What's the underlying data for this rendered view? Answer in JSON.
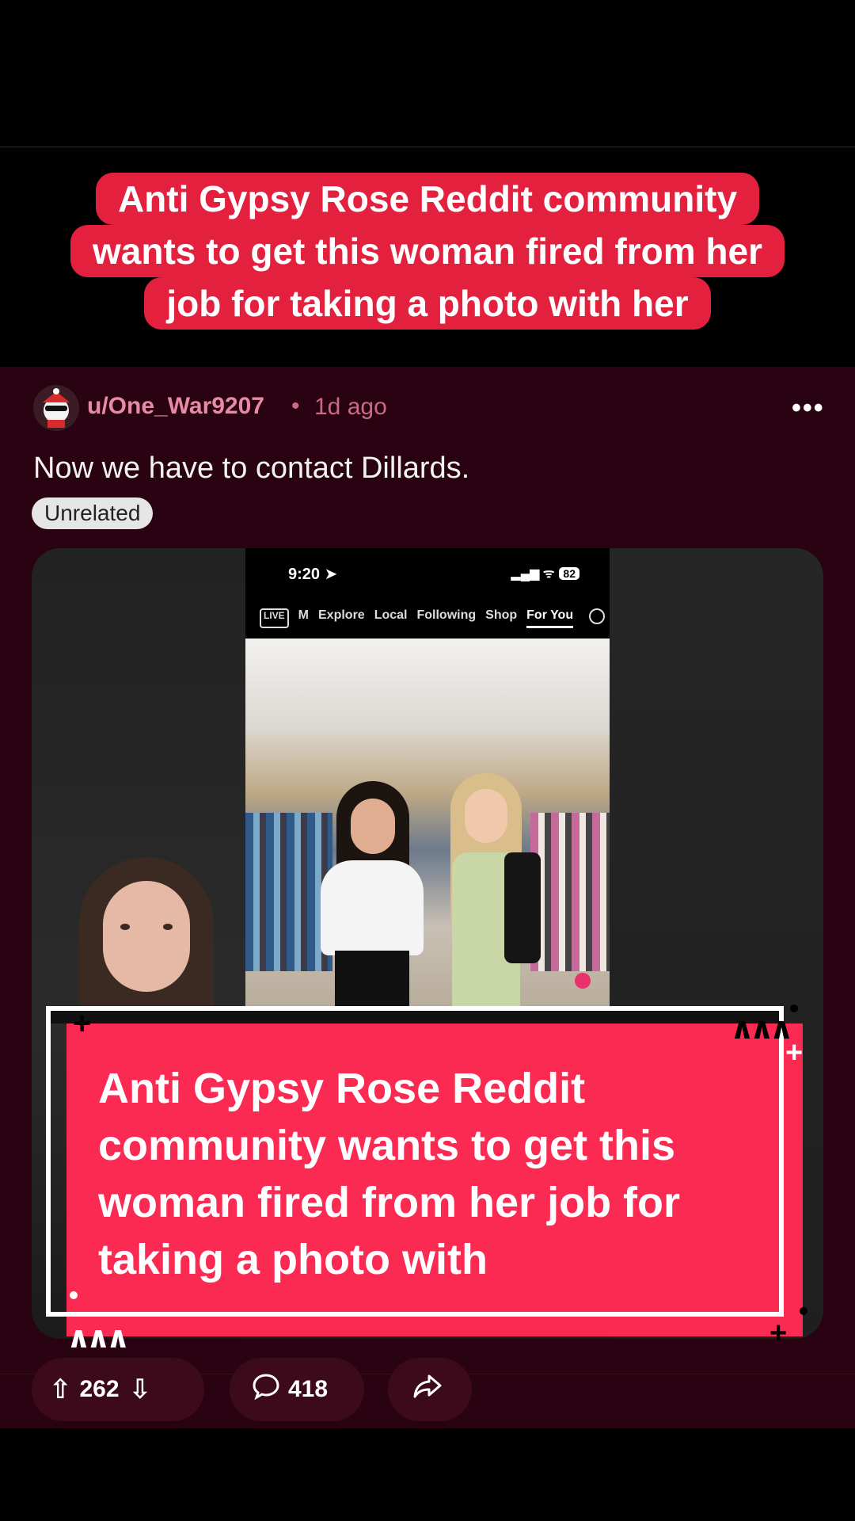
{
  "top_caption": {
    "line1": "Anti Gypsy Rose Reddit community",
    "line2": "wants to get this woman fired from her",
    "line3": "job for taking a photo with her"
  },
  "post": {
    "username": "u/One_War9207",
    "separator": "•",
    "age": "1d ago",
    "more_icon": "more-horizontal-icon",
    "title": "Now we have to contact Dillards.",
    "flair": "Unrelated"
  },
  "embedded_screen": {
    "time": "9:20",
    "battery": "82",
    "tabs": [
      "LIVE",
      "M",
      "Explore",
      "Local",
      "Following",
      "Shop",
      "For You"
    ],
    "active_tab": "For You"
  },
  "overlay_caption": {
    "text": "Anti Gypsy Rose Reddit community wants to get this woman fired from her job for taking a photo with"
  },
  "actions": {
    "upvotes": "262",
    "comments": "418"
  },
  "colors": {
    "background": "#2a0312",
    "caption_red": "#e3213f",
    "overlay_pink": "#fb2a52",
    "username_pink": "#e88aa4"
  }
}
